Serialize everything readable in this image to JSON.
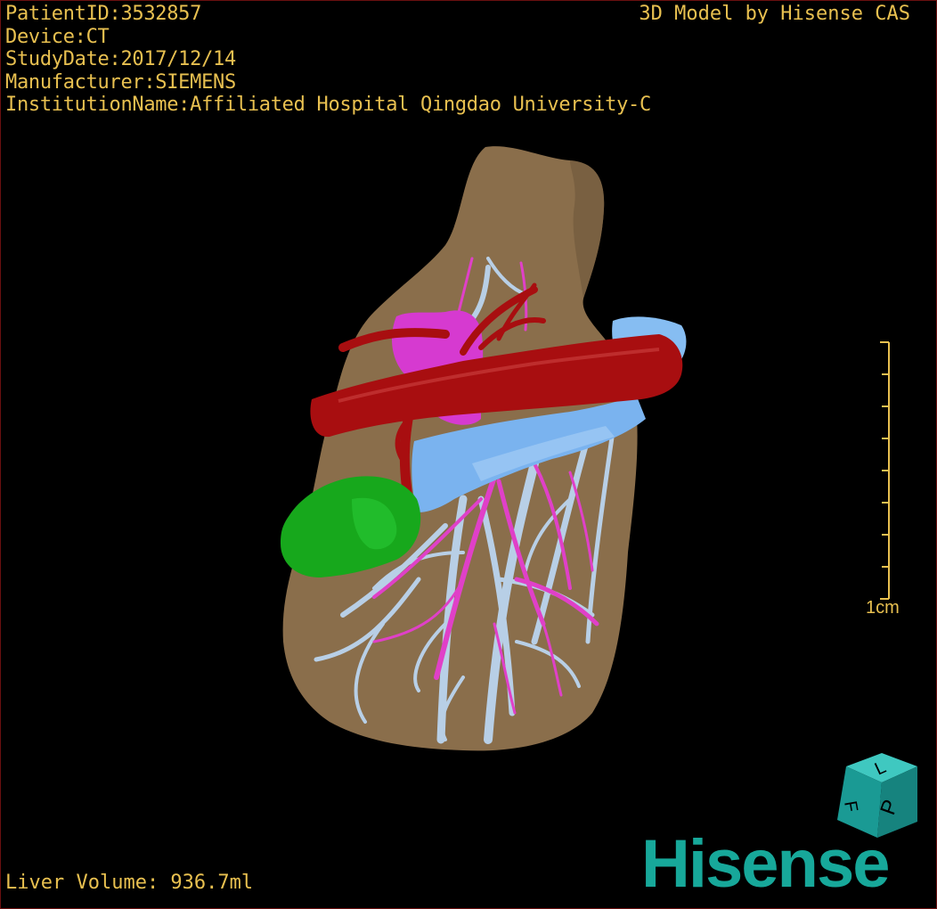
{
  "header": {
    "patient_id": "PatientID:3532857",
    "device": "Device:CT",
    "study_date": "StudyDate:2017/12/14",
    "manufacturer": "Manufacturer:SIEMENS",
    "institution": "InstitutionName:Affiliated Hospital Qingdao University-C"
  },
  "credit": "3D Model by Hisense CAS",
  "footer": {
    "volume": "Liver Volume:  936.7ml"
  },
  "scale_bar": {
    "label": "1cm"
  },
  "orientation_cube": {
    "faces": [
      "L",
      "P",
      "F"
    ],
    "color": "#1aa5a0"
  },
  "brand": "Hisense",
  "colors": {
    "text": "#e8c050",
    "liver": "#8a6e4b",
    "artery": "#a80e10",
    "portal_vein": "#7ab3ef",
    "hepatic_vein": "#b8cfe6",
    "bile_duct": "#e040c8",
    "tumor": "#17a81c",
    "brand": "#17a89a"
  }
}
